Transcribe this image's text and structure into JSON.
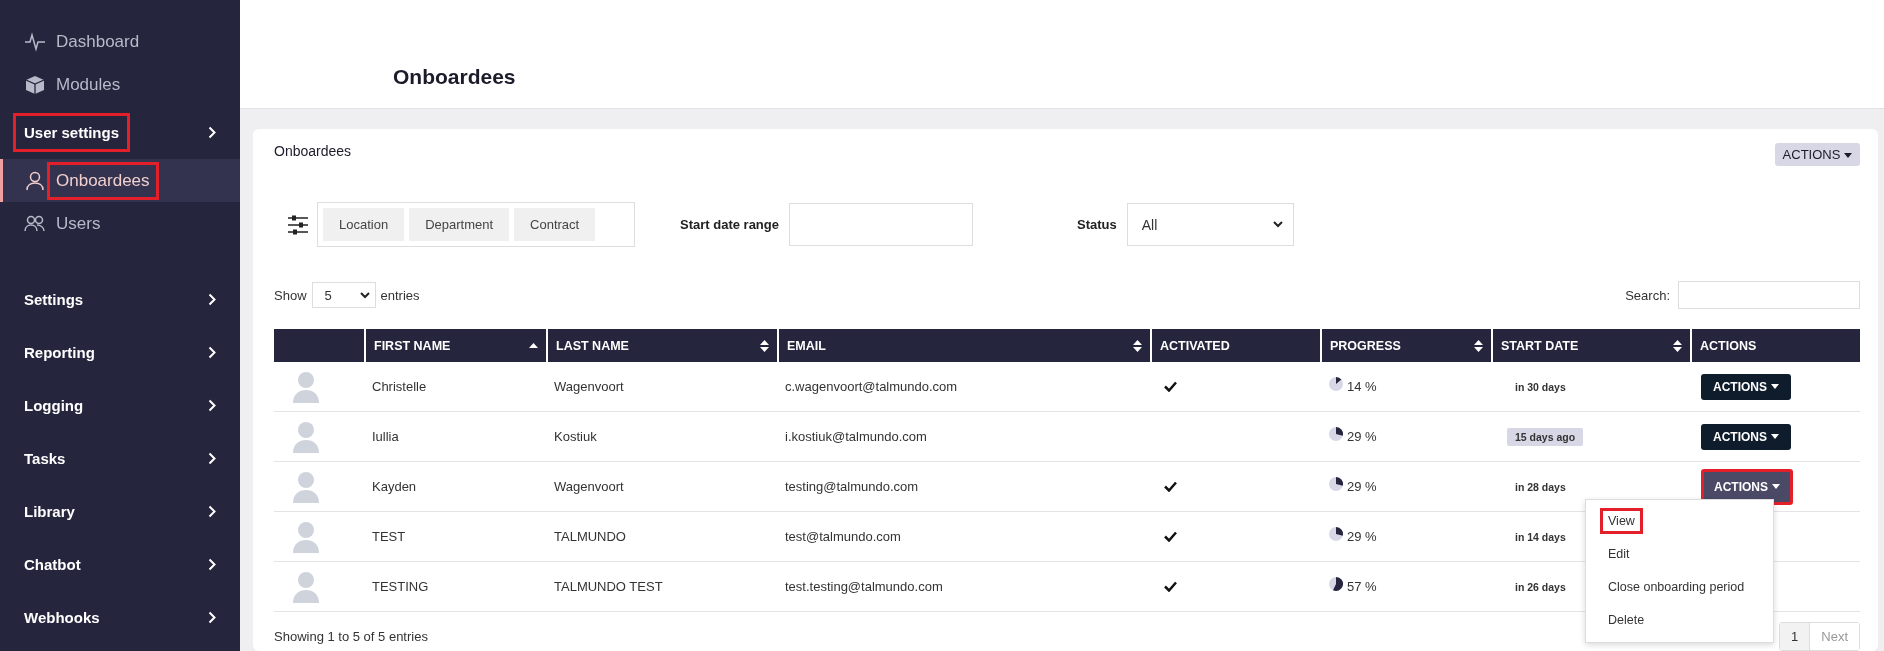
{
  "sidebar": {
    "items": [
      {
        "kind": "link",
        "label": "Dashboard",
        "selected": false,
        "highlighted": false
      },
      {
        "kind": "link",
        "label": "Modules",
        "selected": false,
        "highlighted": false
      },
      {
        "kind": "section",
        "label": "User settings",
        "selected": false,
        "highlighted": true
      },
      {
        "kind": "link",
        "label": "Onboardees",
        "selected": true,
        "highlighted": true
      },
      {
        "kind": "link",
        "label": "Users",
        "selected": false,
        "highlighted": false
      },
      {
        "kind": "gap"
      },
      {
        "kind": "section",
        "label": "Settings",
        "selected": false,
        "highlighted": false
      },
      {
        "kind": "section",
        "label": "Reporting",
        "selected": false,
        "highlighted": false
      },
      {
        "kind": "section",
        "label": "Logging",
        "selected": false,
        "highlighted": false
      },
      {
        "kind": "section",
        "label": "Tasks",
        "selected": false,
        "highlighted": false
      },
      {
        "kind": "section",
        "label": "Library",
        "selected": false,
        "highlighted": false
      },
      {
        "kind": "section",
        "label": "Chatbot",
        "selected": false,
        "highlighted": false
      },
      {
        "kind": "section",
        "label": "Webhooks",
        "selected": false,
        "highlighted": false
      }
    ]
  },
  "page": {
    "title": "Onboardees"
  },
  "card": {
    "title": "Onboardees",
    "actions_button": "ACTIONS",
    "filters": {
      "chips": [
        "Location",
        "Department",
        "Contract"
      ],
      "date_label": "Start date range",
      "status_label": "Status",
      "status_value": "All"
    },
    "show": {
      "before": "Show",
      "value": "5",
      "after": "entries"
    },
    "search_label": "Search:",
    "table": {
      "columns": [
        {
          "sortable": false,
          "sorted": false
        },
        {
          "label": "FIRST NAME",
          "sortable": true,
          "sorted": true
        },
        {
          "label": "LAST NAME",
          "sortable": true,
          "sorted": false
        },
        {
          "label": "EMAIL",
          "sortable": true,
          "sorted": false
        },
        {
          "label": "ACTIVATED",
          "sortable": false,
          "sorted": false
        },
        {
          "label": "PROGRESS",
          "sortable": true,
          "sorted": false
        },
        {
          "label": "START DATE",
          "sortable": true,
          "sorted": false
        },
        {
          "label": "ACTIONS",
          "sortable": false,
          "sorted": false
        }
      ],
      "rows": [
        {
          "first_name": "Christelle",
          "last_name": "Wagenvoort",
          "email": "c.wagenvoort@talmundo.com",
          "activated": true,
          "progress": "14 %",
          "start_date": "in 30 days",
          "past": false,
          "action": "ACTIONS",
          "open": false,
          "highlighted": false
        },
        {
          "first_name": "Iullia",
          "last_name": "Kostiuk",
          "email": "i.kostiuk@talmundo.com",
          "activated": false,
          "progress": "29 %",
          "start_date": "15 days ago",
          "past": true,
          "action": "ACTIONS",
          "open": false,
          "highlighted": false
        },
        {
          "first_name": "Kayden",
          "last_name": "Wagenvoort",
          "email": "testing@talmundo.com",
          "activated": true,
          "progress": "29 %",
          "start_date": "in 28 days",
          "past": false,
          "action": "ACTIONS",
          "open": true,
          "highlighted": true
        },
        {
          "first_name": "TEST",
          "last_name": "TALMUNDO",
          "email": "test@talmundo.com",
          "activated": true,
          "progress": "29 %",
          "start_date": "in 14 days",
          "past": false
        },
        {
          "first_name": "TESTING",
          "last_name": "TALMUNDO TEST",
          "email": "test.testing@talmundo.com",
          "activated": true,
          "progress": "57 %",
          "start_date": "in 26 days",
          "past": false
        }
      ]
    },
    "menu": [
      {
        "label": "View",
        "highlighted": true
      },
      {
        "label": "Edit",
        "highlighted": false
      },
      {
        "label": "Close onboarding period",
        "highlighted": false
      },
      {
        "label": "Delete",
        "highlighted": false
      }
    ],
    "info": "Showing 1 to 5 of 5 entries",
    "pagination": [
      {
        "label": "1",
        "selected": true,
        "disabled": false
      },
      {
        "label": "Next",
        "selected": false,
        "disabled": true
      }
    ]
  }
}
